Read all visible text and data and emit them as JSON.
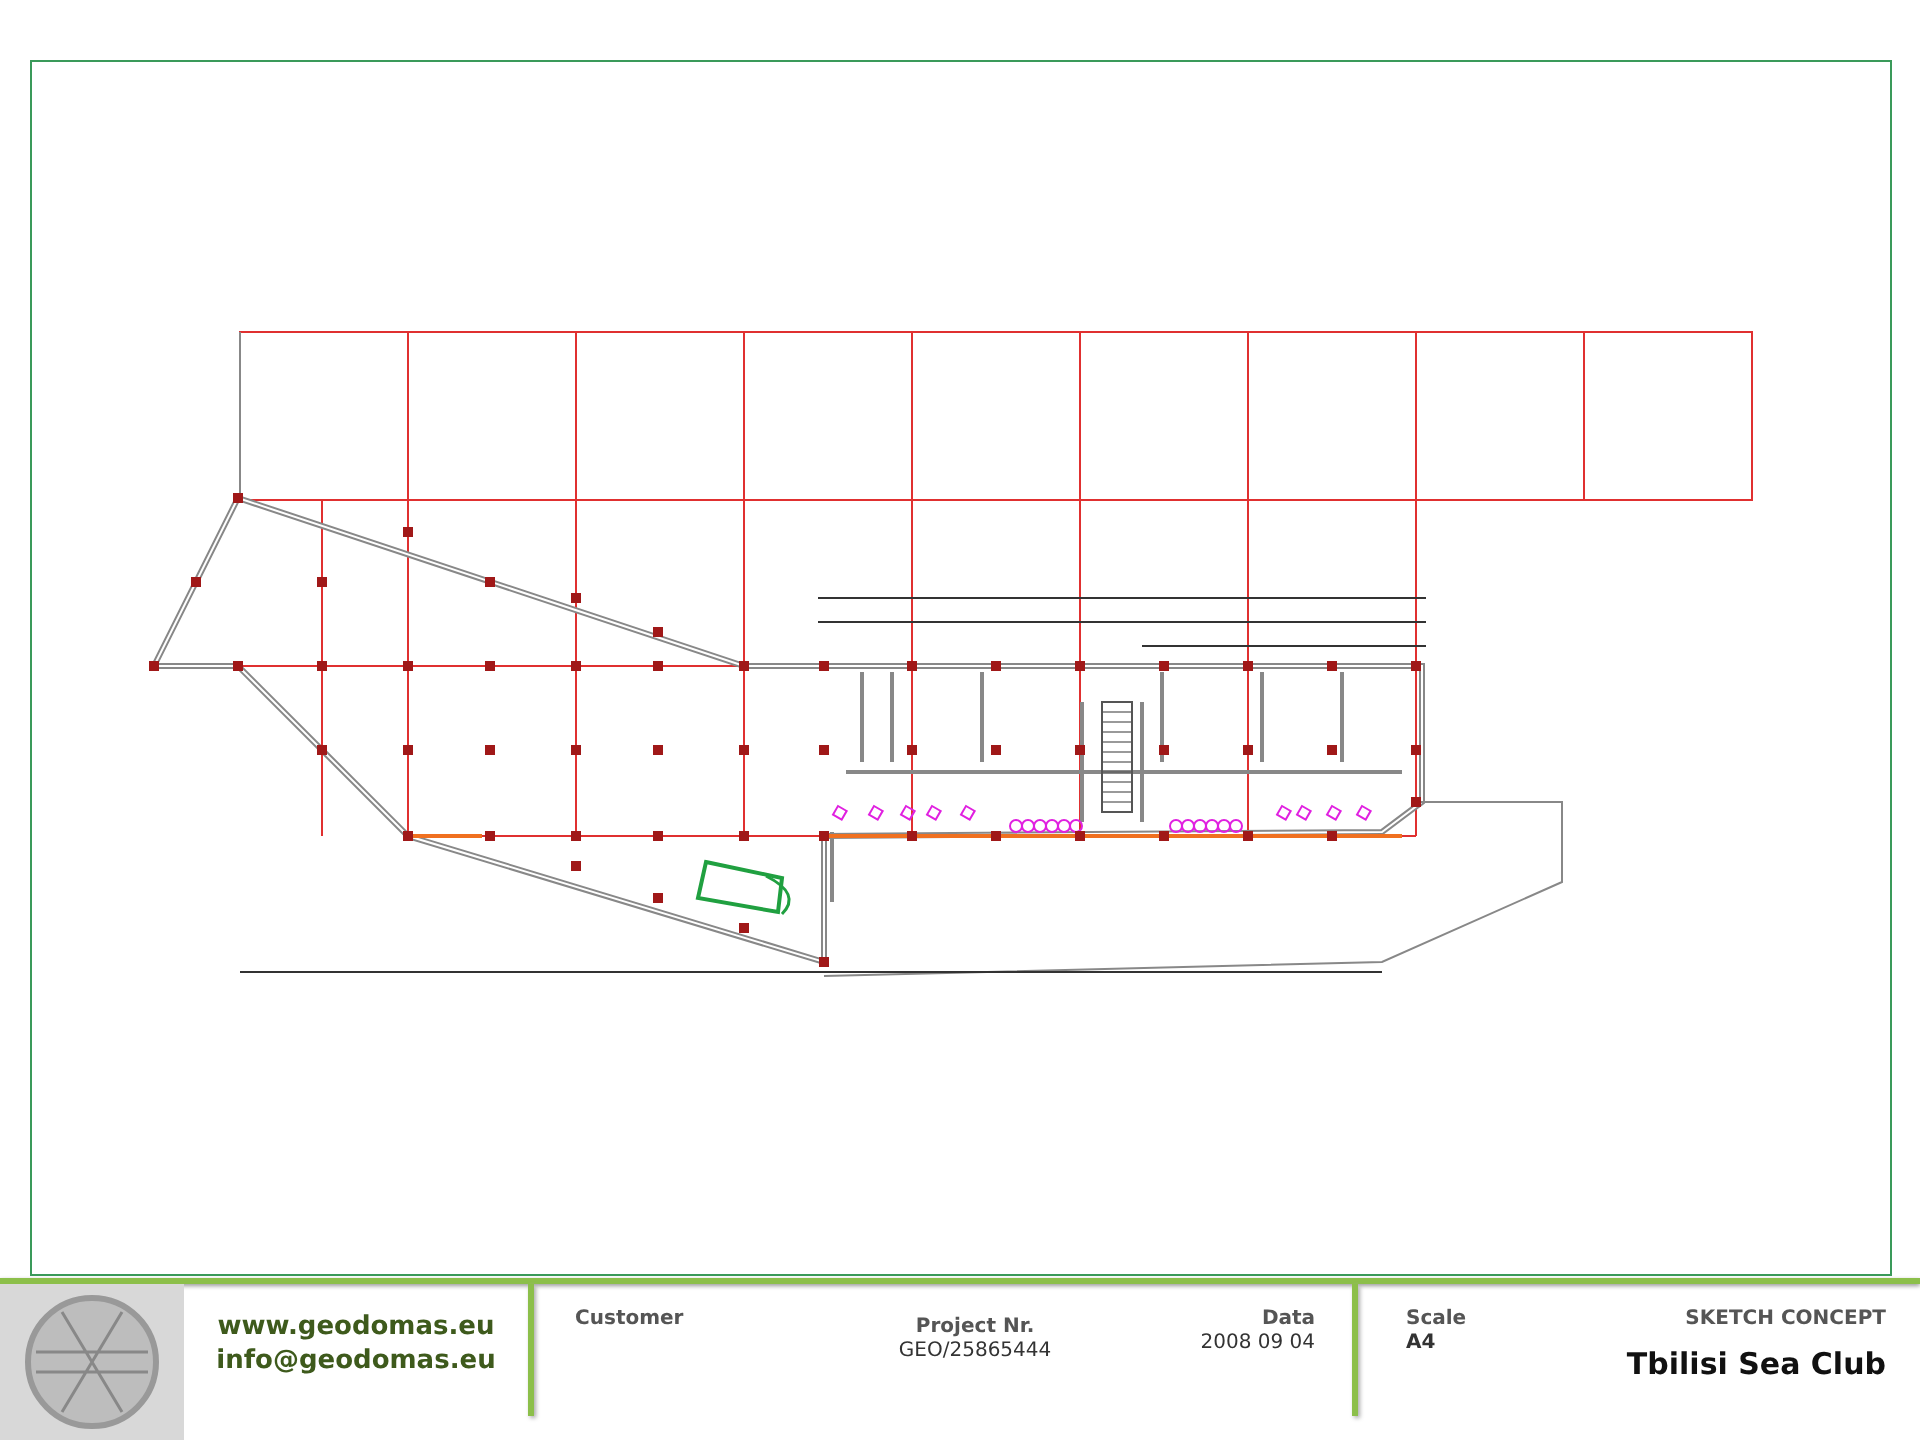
{
  "footer": {
    "website": "www.geodomas.eu",
    "email": "info@geodomas.eu",
    "customer": {
      "label": "Customer"
    },
    "project": {
      "label": "Project Nr.",
      "value": "GEO/25865444"
    },
    "date": {
      "label": "Data",
      "value": "2008 09 04"
    },
    "scale": {
      "label": "Scale",
      "value": "A4"
    },
    "document_type": "SKETCH CONCEPT",
    "project_title": "Tbilisi Sea Club"
  }
}
